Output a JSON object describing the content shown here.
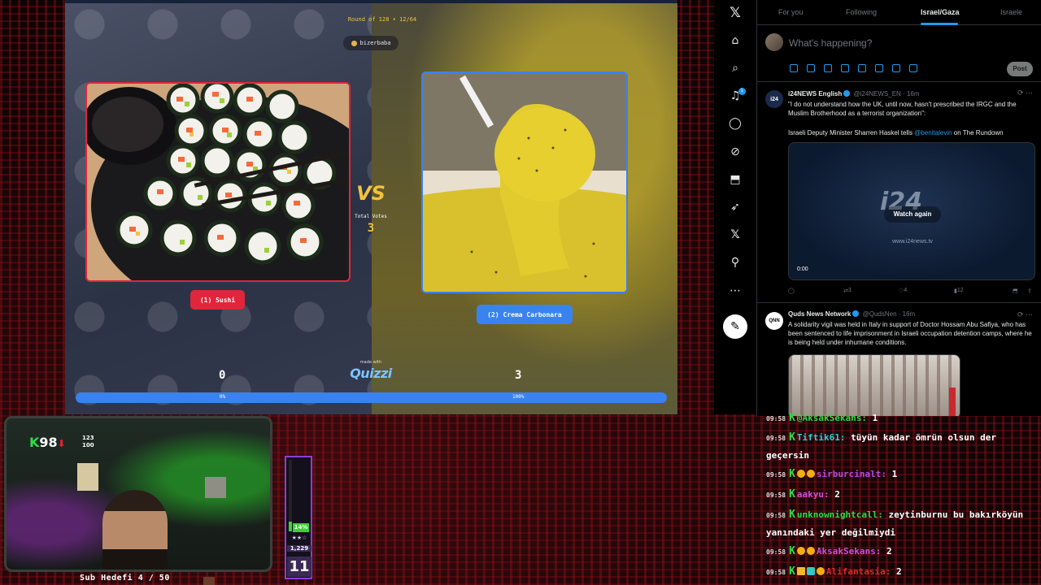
{
  "quiz": {
    "round_label": "Round of 128 • 12/64",
    "creator": "bizerbaba",
    "left": {
      "label": "(1) Sushi",
      "score": "0",
      "percent_text": "0%",
      "color": "#e0263b"
    },
    "right": {
      "label": "(2) Crema Carbonara",
      "score": "3",
      "percent_text": "100%",
      "color": "#3a82f0"
    },
    "vs_text": "VS",
    "total_votes_label": "Total Votes",
    "total_votes": "3",
    "made_with": "made with",
    "brand": "Quizzi",
    "left_share": 0
  },
  "twitter": {
    "tabs": [
      "For you",
      "Following",
      "Israel/Gaza",
      "Israele"
    ],
    "active_tab": "Israel/Gaza",
    "compose_placeholder": "What's happening?",
    "post_label": "Post",
    "notification_count": "1",
    "tweets": [
      {
        "avatar_text": "i24",
        "name": "i24NEWS English",
        "handle": "@i24NEWS_EN",
        "time": "16m",
        "text1": "\"I do not understand how the UK, until now, hasn't prescribed the IRGC and the Muslim Brotherhood as a terrorist organization\":",
        "text2_prefix": "Israeli Deputy Minister Sharren Haskel tells ",
        "text2_link": "@benitalevin",
        "text2_suffix": " on The Rundown",
        "video_logo": "i24",
        "video_watch": "Watch again",
        "video_url": "www.i24news.tv",
        "video_time": "0:00",
        "retweets": "3",
        "likes": "4",
        "views": "12"
      },
      {
        "avatar_text": "QNN",
        "name": "Quds News Network",
        "handle": "@QudsNen",
        "time": "16m",
        "text1": "A solidarity vigil was held in Italy in support of Doctor Hossam Abu Safiya, who has been sentenced to life imprisonment in Israeli occupation detention camps, where he is being held under inhumane conditions."
      }
    ]
  },
  "webcam": {
    "k_value": "98",
    "stat_top": "123",
    "stat_bottom": "100",
    "sub_goal": "Sub Hedefi 4 / 50"
  },
  "meter": {
    "percent": 14,
    "percent_text": "14%",
    "stars": "★★☆",
    "count": "1,229",
    "level": "11"
  },
  "chat": [
    {
      "time": "09:58",
      "badges": [],
      "user": "@AksakSekans:",
      "user_color": "#2edc4a",
      "msg": "1"
    },
    {
      "time": "09:58",
      "badges": [],
      "user": "Tiftik61:",
      "user_color": "#2ecde0",
      "msg": "tüyün kadar ömrün olsun der geçersin"
    },
    {
      "time": "09:58",
      "badges": [
        "coin",
        "gem"
      ],
      "user": "sirburcinalt:",
      "user_color": "#b24be6",
      "msg": "1"
    },
    {
      "time": "09:58",
      "badges": [],
      "user": "aakyu:",
      "user_color": "#d64be0",
      "msg": "2"
    },
    {
      "time": "09:58",
      "badges": [],
      "user": "unknownightcall:",
      "user_color": "#2edc4a",
      "msg": "zeytinburnu bu bakırköyün yanındaki yer değilmiydi"
    },
    {
      "time": "09:58",
      "badges": [
        "coin",
        "gem"
      ],
      "user": "AksakSekans:",
      "user_color": "#d64be0",
      "msg": "2"
    },
    {
      "time": "09:58",
      "badges": [
        "crown",
        "sq",
        "coin"
      ],
      "user": "Alifantasia:",
      "user_color": "#e02a2a",
      "msg": "2"
    }
  ]
}
